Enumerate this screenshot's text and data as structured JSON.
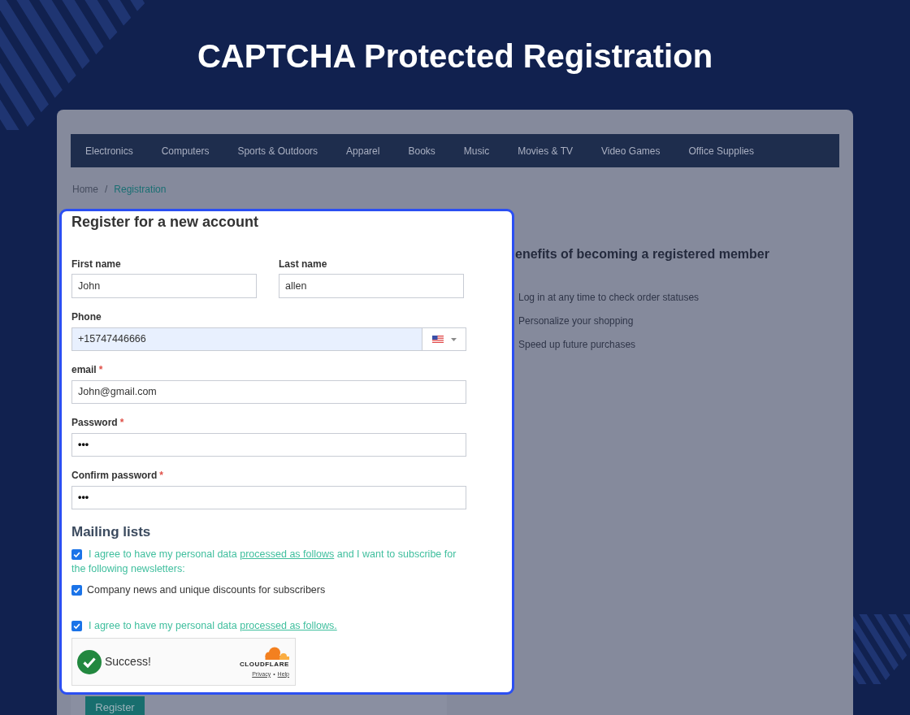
{
  "heading": "CAPTCHA Protected Registration",
  "nav": {
    "items": [
      "Electronics",
      "Computers",
      "Sports & Outdoors",
      "Apparel",
      "Books",
      "Music",
      "Movies & TV",
      "Video Games",
      "Office Supplies"
    ]
  },
  "breadcrumb": {
    "separator": "/",
    "items": [
      {
        "label": "Home",
        "current": false
      },
      {
        "label": "Registration",
        "current": true
      }
    ]
  },
  "form": {
    "title": "Register for a new account",
    "name_fields": [
      {
        "kind": "text",
        "label": "First name",
        "value": "John",
        "autofilled": false
      },
      {
        "kind": "text",
        "label": "Last name",
        "value": "allen",
        "autofilled": false
      }
    ],
    "fields": [
      {
        "kind": "phone",
        "label": "Phone",
        "value": "+15747446666",
        "autofilled": true
      },
      {
        "kind": "text",
        "label": "email",
        "required_mark": "*",
        "value": "John@gmail.com",
        "autofilled": false
      },
      {
        "kind": "password",
        "label": "Password",
        "required_mark": "*",
        "value": "•••",
        "autofilled": false
      },
      {
        "kind": "password",
        "label": "Confirm password",
        "required_mark": "*",
        "value": "•••",
        "autofilled": false
      }
    ],
    "mailing_lists": {
      "title": "Mailing lists",
      "items": [
        {
          "kind": "agreement",
          "checked": true,
          "text": "I agree to have my personal data ",
          "link": "processed as follows",
          "after": " and I want to subscribe for the following newsletters:"
        },
        {
          "kind": "newsletter",
          "checked": true,
          "text": "Company news and unique discounts for subscribers"
        }
      ]
    },
    "terms": {
      "kind": "agreement",
      "checked": true,
      "text": "I agree to have my personal data ",
      "link": "processed as follows."
    },
    "captcha": {
      "verified": true,
      "status": "Success!",
      "brand": "CLOUDFLARE",
      "links": [
        "Privacy",
        "Help"
      ],
      "link_separator": "•"
    },
    "submit": "Register"
  },
  "benefits": {
    "title": "enefits of becoming a registered member",
    "items": [
      "Log in at any time to check order statuses",
      "Personalize your shopping",
      "Speed up future purchases"
    ]
  }
}
